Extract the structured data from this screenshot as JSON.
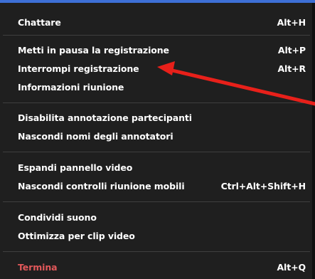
{
  "menu": {
    "items": [
      {
        "label": "Chattare",
        "shortcut": "Alt+H"
      },
      {
        "label": "Metti in pausa la registrazione",
        "shortcut": "Alt+P"
      },
      {
        "label": "Interrompi registrazione",
        "shortcut": "Alt+R"
      },
      {
        "label": "Informazioni riunione",
        "shortcut": ""
      },
      {
        "label": "Disabilita annotazione partecipanti",
        "shortcut": ""
      },
      {
        "label": "Nascondi nomi degli annotatori",
        "shortcut": ""
      },
      {
        "label": "Espandi pannello video",
        "shortcut": ""
      },
      {
        "label": "Nascondi controlli riunione mobili",
        "shortcut": "Ctrl+Alt+Shift+H"
      },
      {
        "label": "Condividi suono",
        "shortcut": ""
      },
      {
        "label": "Ottimizza per clip video",
        "shortcut": ""
      },
      {
        "label": "Termina",
        "shortcut": "Alt+Q"
      }
    ]
  },
  "annotation": {
    "color": "#e8201a"
  },
  "colors": {
    "danger": "#e2585a",
    "accent_strip": "#3d6fd6"
  }
}
